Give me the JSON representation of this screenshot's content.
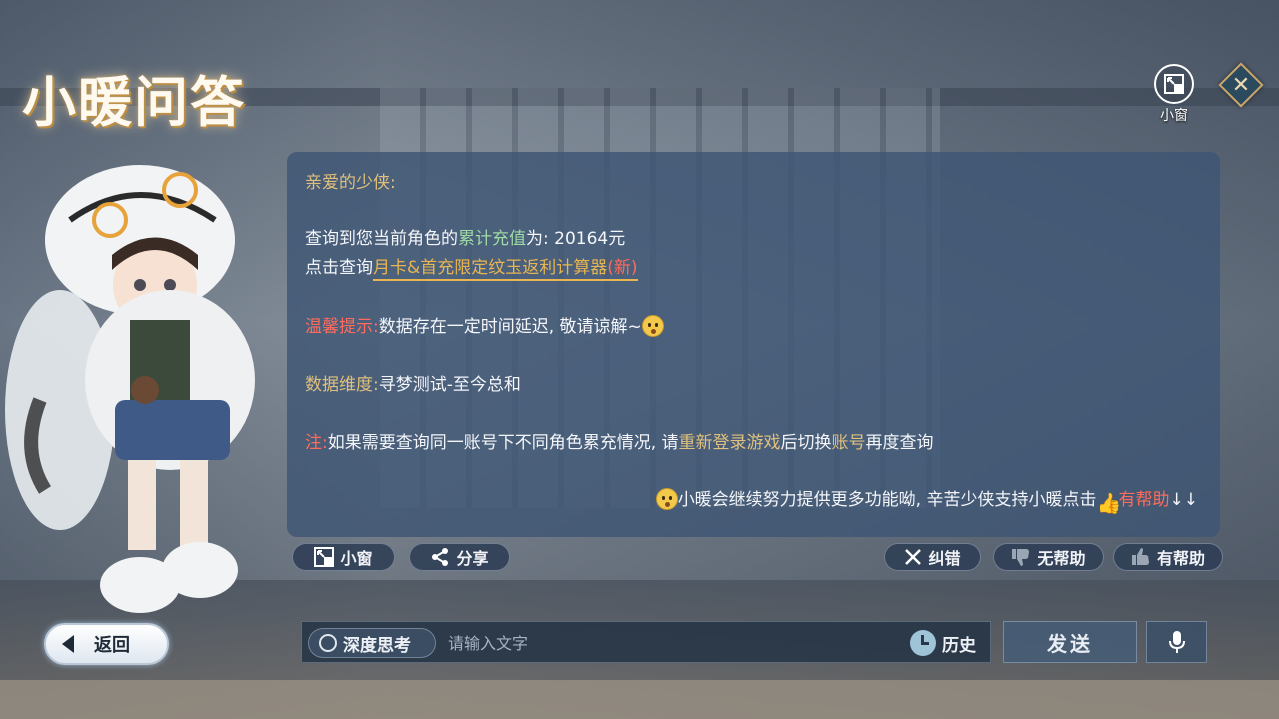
{
  "header": {
    "title": "小暖问答",
    "mini_window_label": "小窗"
  },
  "message": {
    "greeting": "亲爱的少侠:",
    "recharge_prefix": "查询到您当前角色的",
    "recharge_keyword": "累计充值",
    "recharge_suffix": "为: 20164元",
    "calc_prefix": "点击查询",
    "calc_link": "月卡&首充限定纹玉返利计算器",
    "calc_new": "(新)",
    "tip_label": "温馨提示:",
    "tip_text": "数据存在一定时间延迟, 敬请谅解~",
    "dimension_label": "数据维度:",
    "dimension_value": "寻梦测试-至今总和",
    "note_label": "注:",
    "note_text_1": "如果需要查询同一账号下不同角色累充情况, 请",
    "note_keyword_1": "重新登录游戏",
    "note_text_2": "后切换",
    "note_keyword_2": "账号",
    "note_text_3": "再度查询",
    "closing_text": "小暖会继续努力提供更多功能呦, 辛苦少侠支持小暖点击",
    "closing_link": "有帮助",
    "closing_arrows": "↓↓"
  },
  "actions": {
    "mini_window": "小窗",
    "share": "分享",
    "correct": "纠错",
    "not_helpful": "无帮助",
    "helpful": "有帮助"
  },
  "bottom": {
    "back": "返回",
    "deep_think": "深度思考",
    "input_placeholder": "请输入文字",
    "history": "历史",
    "send": "发送"
  },
  "icons": {
    "mini_window": "mini-window-icon",
    "close": "close-icon",
    "share": "share-icon",
    "correct": "x-icon",
    "thumbs_down": "thumbs-down-icon",
    "thumbs_up": "thumbs-up-icon",
    "back": "back-arrow-icon",
    "history": "clock-icon",
    "mic": "microphone-icon"
  },
  "colors": {
    "panel": "#3e5674",
    "gold": "#e0c07e",
    "green": "#9ed9a6",
    "red": "#ff6b5c",
    "link": "#e9b550"
  }
}
